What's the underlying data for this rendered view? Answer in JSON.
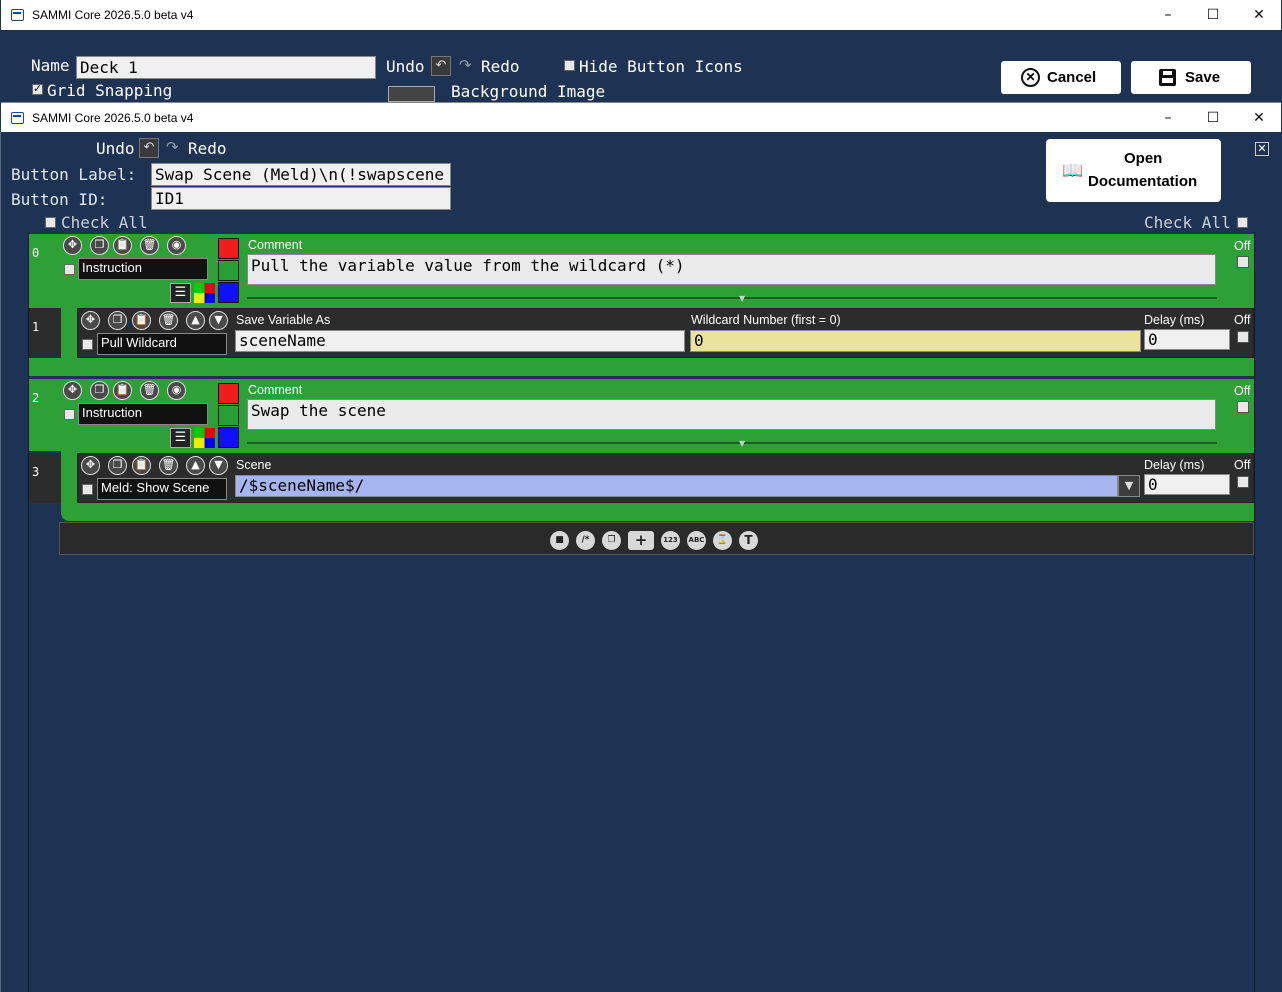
{
  "outer_window": {
    "title": "SAMMI Core 2026.5.0 beta v4",
    "name_label": "Name",
    "name_value": "Deck 1",
    "undo_label": "Undo",
    "redo_label": "Redo",
    "hide_icons_label": "Hide Button Icons",
    "grid_snapping_label": "Grid Snapping",
    "background_image_label": "Background Image",
    "cancel_label": "Cancel",
    "save_label": "Save"
  },
  "inner_window": {
    "title": "SAMMI Core 2026.5.0 beta v4",
    "undo_label": "Undo",
    "redo_label": "Redo",
    "button_label_caption": "Button Label:",
    "button_label_value": "Swap Scene (Meld)\\n(!swapscene",
    "button_id_caption": "Button ID:",
    "button_id_value": "ID1",
    "check_all_label": "Check All",
    "open_docs_line1": "Open",
    "open_docs_line2": "Documentation"
  },
  "rows": [
    {
      "index": "0",
      "command": "Instruction",
      "comment_label": "Comment",
      "comment_value": "Pull the variable value from the wildcard (*)",
      "off_label": "Off"
    },
    {
      "index": "1",
      "command": "Pull Wildcard",
      "field1_label": "Save Variable As",
      "field1_value": "sceneName",
      "field2_label": "Wildcard Number (first = 0)",
      "field2_value": "0",
      "delay_label": "Delay (ms)",
      "delay_value": "0",
      "off_label": "Off"
    },
    {
      "index": "2",
      "command": "Instruction",
      "comment_label": "Comment",
      "comment_value": "Swap the scene",
      "off_label": "Off"
    },
    {
      "index": "3",
      "command": "Meld: Show Scene",
      "field1_label": "Scene",
      "field1_value": "/$sceneName$/",
      "delay_label": "Delay (ms)",
      "delay_value": "0",
      "off_label": "Off"
    }
  ],
  "bottom_toolbar": {
    "icons": [
      "list-icon",
      "regex-icon",
      "paste-icon",
      "add-icon",
      "number-icon",
      "text-icon",
      "hourglass-icon",
      "text-t-icon"
    ],
    "num_label": "123",
    "abc_label": "ABC"
  },
  "colors": {
    "background": "#1e3354",
    "green_row": "#2da138",
    "dark_row": "#2c2c2c",
    "highlight_yellow": "#e9e39b",
    "highlight_blue": "#a6b4f0"
  }
}
